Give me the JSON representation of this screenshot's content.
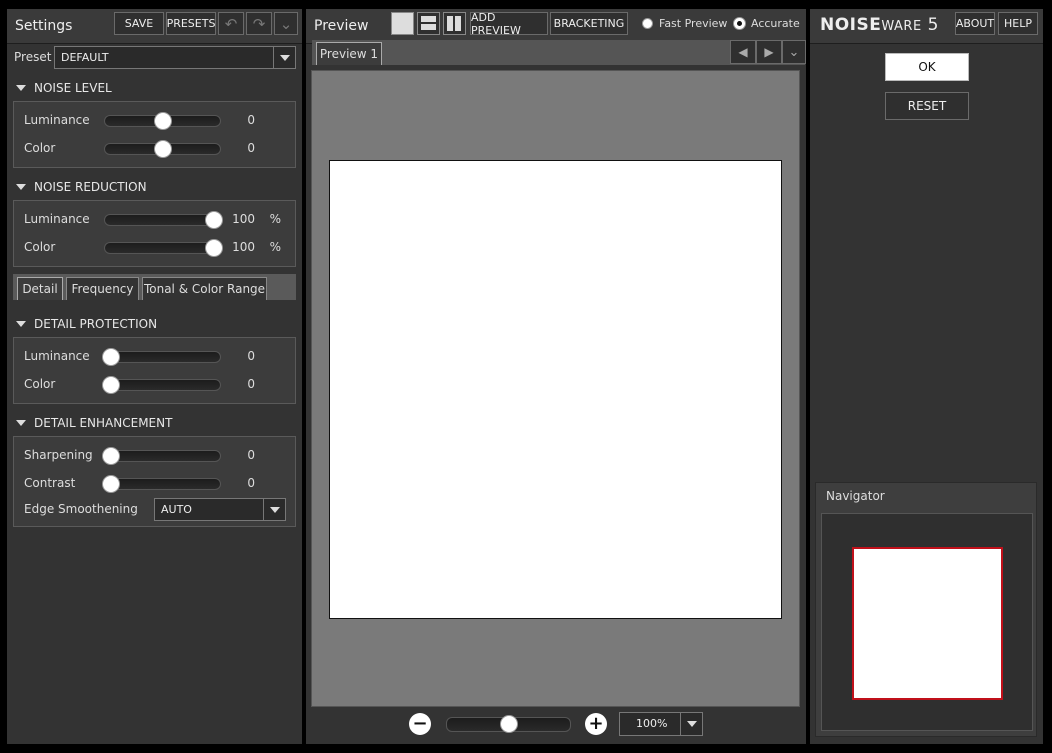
{
  "settings": {
    "title": "Settings",
    "save_label": "SAVE",
    "presets_label": "PRESETS",
    "undo_icon": "undo-icon",
    "redo_icon": "redo-icon",
    "menu_icon": "chevron-down-icon",
    "preset_label": "Preset",
    "preset_value": "DEFAULT",
    "sections": {
      "noise_level": {
        "title": "NOISE LEVEL",
        "rows": [
          {
            "label": "Luminance",
            "value": "0",
            "unit": "",
            "level": 0.5
          },
          {
            "label": "Color",
            "value": "0",
            "unit": "",
            "level": 0.5
          }
        ]
      },
      "noise_reduction": {
        "title": "NOISE REDUCTION",
        "rows": [
          {
            "label": "Luminance",
            "value": "100",
            "unit": "%",
            "level": 0.95
          },
          {
            "label": "Color",
            "value": "100",
            "unit": "%",
            "level": 0.95
          }
        ]
      },
      "detail_protection": {
        "title": "DETAIL PROTECTION",
        "rows": [
          {
            "label": "Luminance",
            "value": "0",
            "unit": "",
            "level": 0.05
          },
          {
            "label": "Color",
            "value": "0",
            "unit": "",
            "level": 0.05
          }
        ]
      },
      "detail_enhancement": {
        "title": "DETAIL ENHANCEMENT",
        "rows": [
          {
            "label": "Sharpening",
            "value": "0",
            "unit": "",
            "level": 0.05
          },
          {
            "label": "Contrast",
            "value": "0",
            "unit": "",
            "level": 0.05
          }
        ],
        "edge_label": "Edge Smoothening",
        "edge_value": "AUTO"
      }
    },
    "tabs": [
      "Detail",
      "Frequency",
      "Tonal & Color Range"
    ]
  },
  "preview": {
    "title": "Preview",
    "add_preview_label": "ADD PREVIEW",
    "bracketing_label": "BRACKETING",
    "fast_preview_label": "Fast Preview",
    "accurate_label": "Accurate",
    "mode_selected": "Accurate",
    "tab_label": "Preview 1",
    "zoom_value": "100%",
    "zoom_level": 0.5
  },
  "right": {
    "logo_bold": "NOISE",
    "logo_rest": "WARE",
    "logo_version": "5",
    "about_label": "ABOUT",
    "help_label": "HELP",
    "ok_label": "OK",
    "reset_label": "RESET",
    "navigator_title": "Navigator"
  },
  "colors": {
    "navigator_frame": "#c0101a"
  }
}
